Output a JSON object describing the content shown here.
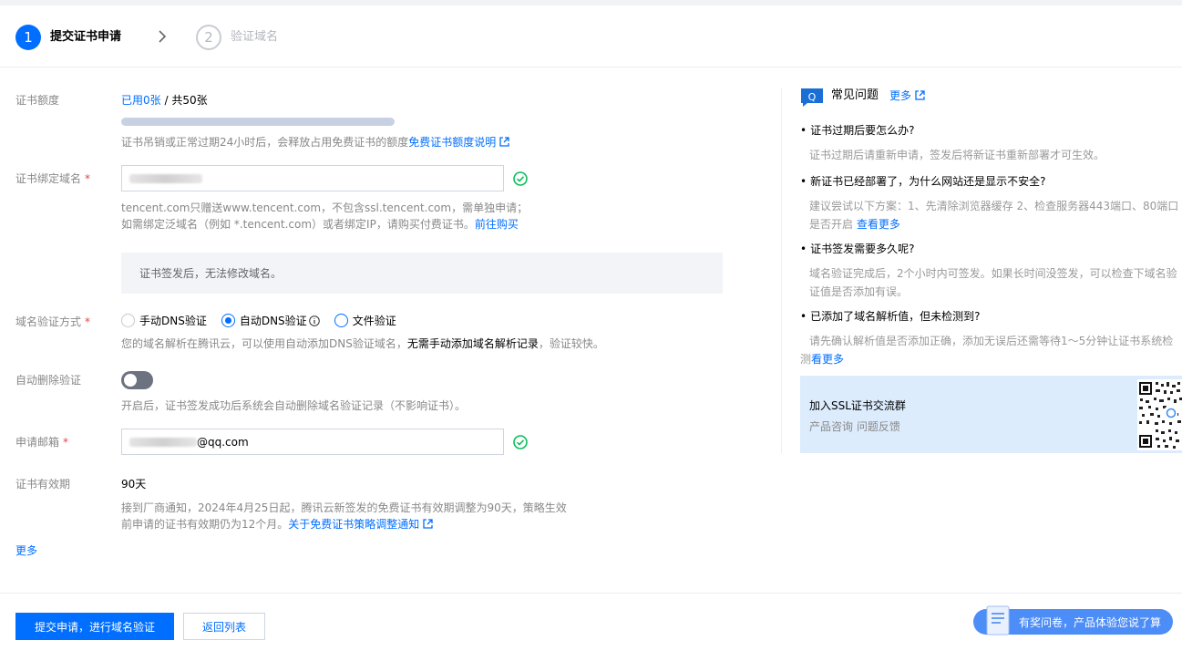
{
  "steps": [
    {
      "num": "1",
      "label": "提交证书申请"
    },
    {
      "num": "2",
      "label": "验证域名"
    }
  ],
  "quota": {
    "label": "证书额度",
    "used": "已用0张",
    "sep": " / ",
    "total": "共50张",
    "used_fraction": 0,
    "help": "证书吊销或正常过期24小时后，会释放占用免费证书的额度",
    "help_link": "免费证书额度说明"
  },
  "domain": {
    "label": "证书绑定域名",
    "required": "*",
    "help_line1": "tencent.com只赠送www.tencent.com，不包含ssl.tencent.com，需单独申请；",
    "help_line2": "如需绑定泛域名（例如 *.tencent.com）或者绑定IP，请购买付费证书。",
    "help_link": "前往购买",
    "notice": "证书签发后，无法修改域名。"
  },
  "verify": {
    "label": "域名验证方式",
    "required": "*",
    "options": [
      "手动DNS验证",
      "自动DNS验证",
      "文件验证"
    ],
    "selected": "自动DNS验证",
    "help_pre": "您的域名解析在腾讯云，可以使用自动添加DNS验证域名，",
    "help_bold": "无需手动添加域名解析记录",
    "help_post": "，验证较快。"
  },
  "auto_delete": {
    "label": "自动删除验证",
    "enabled": false,
    "help": "开启后，证书签发成功后系统会自动删除域名验证记录（不影响证书）。"
  },
  "email": {
    "label": "申请邮箱",
    "required": "*",
    "suffix": "@qq.com"
  },
  "validity": {
    "label": "证书有效期",
    "value": "90天",
    "help_line1": "接到厂商通知，2024年4月25日起，腾讯云新签发的免费证书有效期调整为90天，策略生效",
    "help_line2": "前申请的证书有效期仍为12个月。",
    "help_link": "关于免费证书策略调整通知"
  },
  "more_label": "更多",
  "buttons": {
    "submit": "提交申请，进行域名验证",
    "back": "返回列表"
  },
  "faq": {
    "title": "常见问题",
    "more": "更多",
    "items": [
      {
        "q": "证书过期后要怎么办?",
        "a": "证书过期后请重新申请，签发后将新证书重新部署才可生效。"
      },
      {
        "q": "新证书已经部署了，为什么网站还是显示不安全?",
        "a": "建议尝试以下方案：1、先清除浏览器缓存 2、检查服务器443端口、80端口是否开启",
        "a_link": "查看更多"
      },
      {
        "q": "证书签发需要多久呢?",
        "a": "域名验证完成后，2个小时内可签发。如果长时间没签发，可以检查下域名验证值是否添加有误。"
      },
      {
        "q": "已添加了域名解析值，但未检测到?",
        "a": "请先确认解析值是否添加正确，添加无误后还需等待1～5分钟让证书系统检测",
        "a_link": "看更多"
      }
    ]
  },
  "group": {
    "title": "加入SSL证书交流群",
    "sub": "产品咨询 问题反馈"
  },
  "survey": "有奖问卷，产品体验您说了算",
  "colors": {
    "primary": "#006eff",
    "success": "#0abf5b",
    "required": "#e54545"
  }
}
